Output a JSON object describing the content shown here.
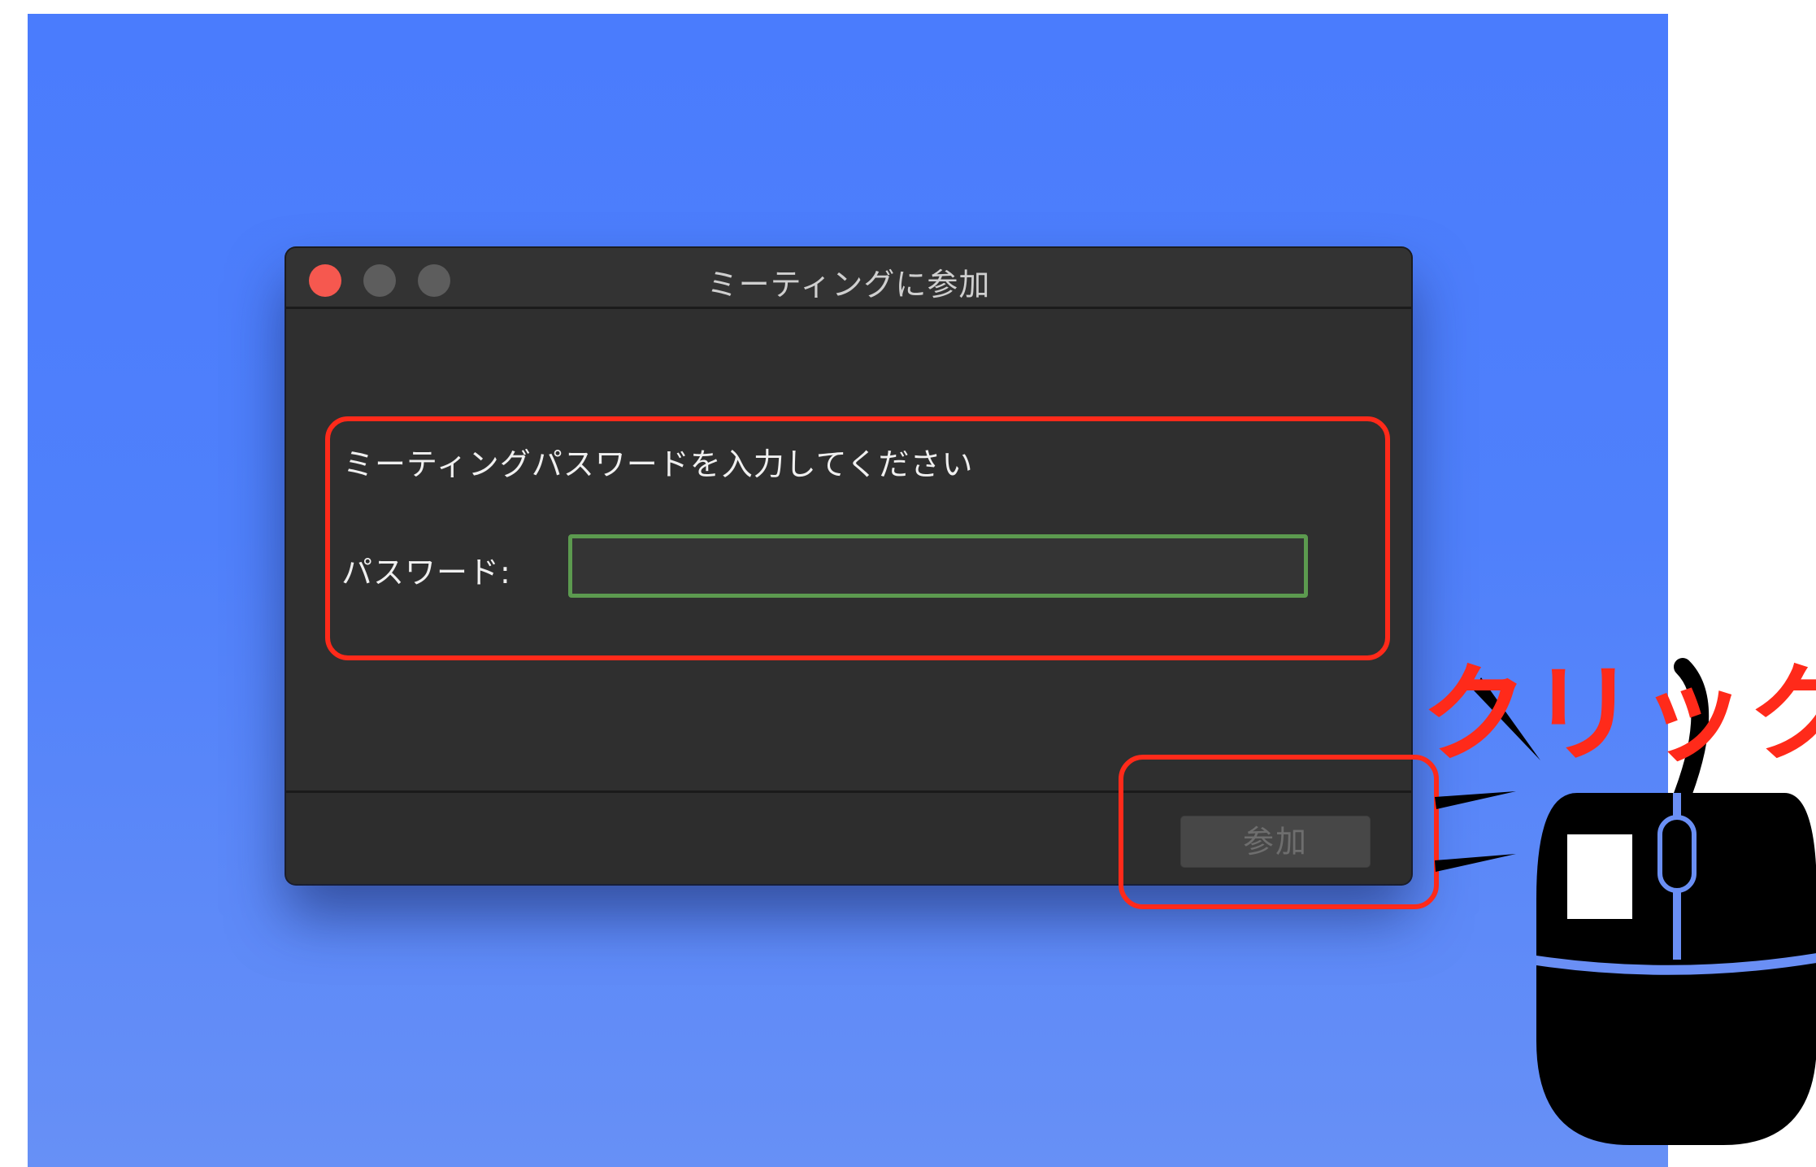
{
  "window": {
    "title": "ミーティングに参加"
  },
  "dialog": {
    "prompt": "ミーティングパスワードを入力してください",
    "password_label": "パスワード:",
    "password_value": "",
    "join_button": "参加"
  },
  "annotation": {
    "click_label": "クリック"
  },
  "colors": {
    "highlight": "#ff2a1a",
    "field_border": "#5c9a4f",
    "desktop": "#4a7cfd",
    "window_bg": "#2f2f2f",
    "close_button": "#f6584f"
  },
  "icons": [
    "close-icon",
    "minimize-icon",
    "maximize-icon",
    "mouse-click-icon"
  ]
}
